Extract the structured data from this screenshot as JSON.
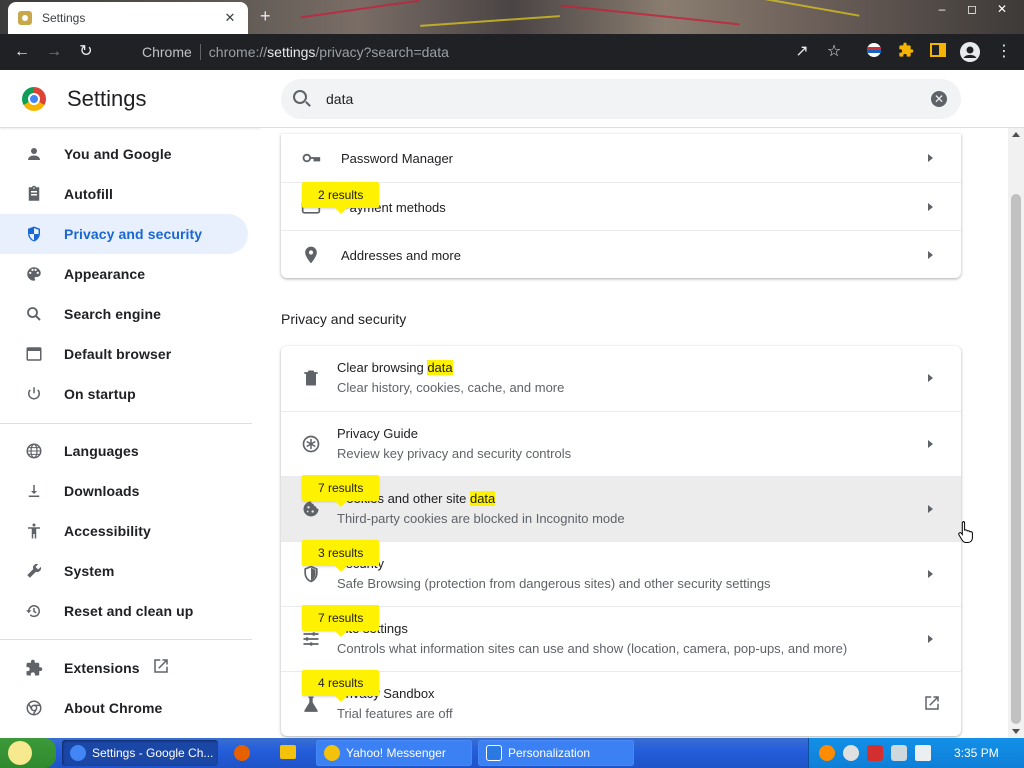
{
  "browser": {
    "tab_title": "Settings",
    "tab_close": "✕",
    "new_tab": "+",
    "window_controls": [
      "–",
      "◻",
      "✕"
    ],
    "site_chip": "Chrome",
    "url_prefix": "chrome://",
    "url_host": "settings",
    "url_path": "/privacy?search=data"
  },
  "header": {
    "title": "Settings",
    "search_value": "data",
    "search_clear": "✕"
  },
  "sidebar": {
    "items": [
      {
        "label": "You and Google",
        "icon": "person-icon"
      },
      {
        "label": "Autofill",
        "icon": "clipboard-icon"
      },
      {
        "label": "Privacy and security",
        "icon": "shield-icon",
        "selected": true
      },
      {
        "label": "Appearance",
        "icon": "palette-icon"
      },
      {
        "label": "Search engine",
        "icon": "search-icon"
      },
      {
        "label": "Default browser",
        "icon": "browser-window-icon"
      },
      {
        "label": "On startup",
        "icon": "power-icon"
      },
      {
        "label": "Languages",
        "icon": "globe-icon"
      },
      {
        "label": "Downloads",
        "icon": "download-icon"
      },
      {
        "label": "Accessibility",
        "icon": "accessibility-icon"
      },
      {
        "label": "System",
        "icon": "wrench-icon"
      },
      {
        "label": "Reset and clean up",
        "icon": "history-icon"
      },
      {
        "label": "Extensions",
        "icon": "puzzle-icon"
      },
      {
        "label": "About Chrome",
        "icon": "chrome-icon"
      }
    ]
  },
  "autofill_card": {
    "rows": [
      {
        "title": "Password Manager",
        "icon": "key-icon"
      },
      {
        "title": "Payment methods",
        "icon": "credit-card-icon"
      },
      {
        "title": "Addresses and more",
        "icon": "location-pin-icon"
      }
    ],
    "bubble": "2 results"
  },
  "privacy_section": {
    "title": "Privacy and security",
    "rows": [
      {
        "title_pre": "Clear browsing ",
        "title_hl": "data",
        "subtitle": "Clear history, cookies, cache, and more",
        "icon": "trash-icon"
      },
      {
        "title_pre": "Privacy Guide",
        "title_hl": "",
        "subtitle": "Review key privacy and security controls",
        "icon": "privacy-guide-icon"
      },
      {
        "title_pre": "Cookies and other site ",
        "title_hl": "data",
        "subtitle": "Third-party cookies are blocked in Incognito mode",
        "icon": "cookie-icon"
      },
      {
        "title_pre": "Security",
        "title_hl": "",
        "subtitle": "Safe Browsing (protection from dangerous sites) and other security settings",
        "icon": "shield-outline-icon"
      },
      {
        "title_pre": "Site settings",
        "title_hl": "",
        "subtitle": "Controls what information sites can use and show (location, camera, pop-ups, and more)",
        "icon": "sliders-icon"
      },
      {
        "title_pre": "Privacy Sandbox",
        "title_hl": "",
        "subtitle": "Trial features are off",
        "icon": "flask-icon"
      }
    ],
    "bubbles": [
      "7 results",
      "3 results",
      "7 results",
      "4 results"
    ]
  },
  "taskbar": {
    "tasks": [
      {
        "label": "Settings - Google Ch...",
        "active": true,
        "color": "#4285f4"
      },
      {
        "label": "Yahoo! Messenger",
        "active": false,
        "color": "#f4c20d"
      },
      {
        "label": "Personalization",
        "active": false,
        "color": "#2a7ae2"
      }
    ],
    "clock": "3:35 PM"
  }
}
